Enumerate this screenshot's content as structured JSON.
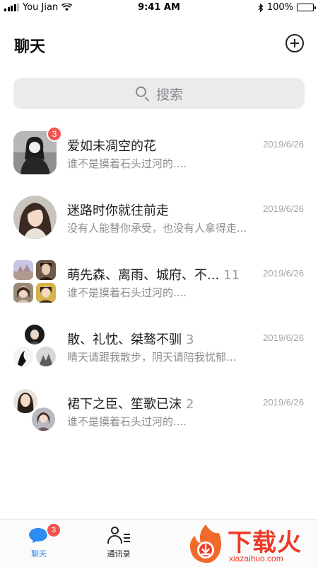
{
  "status_bar": {
    "carrier": "You Jian",
    "time": "9:41 AM",
    "battery": "100%"
  },
  "header": {
    "title": "聊天",
    "add_icon": "plus-circle-icon"
  },
  "search": {
    "placeholder": "搜索",
    "icon": "search-icon"
  },
  "chats": [
    {
      "name": "爱如未凋空的花",
      "count": "",
      "message": "谁不是摸着石头过河的....",
      "date": "2019/6/26",
      "badge": "3"
    },
    {
      "name": "迷路时你就往前走",
      "count": "",
      "message": "没有人能替你承受，也没有人拿得走...",
      "date": "2019/6/26",
      "badge": ""
    },
    {
      "name": "萌先森、离雨、城府、不...",
      "count": "11",
      "message": "谁不是摸着石头过河的....",
      "date": "2019/6/26",
      "badge": ""
    },
    {
      "name": "散、礼忱、桀骜不驯",
      "count": "3",
      "message": "晴天请跟我散步，阴天请陪我忧郁...",
      "date": "2019/6/26",
      "badge": ""
    },
    {
      "name": "裙下之臣、笙歌已沫",
      "count": "2",
      "message": "谁不是摸着石头过河的....",
      "date": "2019/6/26",
      "badge": ""
    }
  ],
  "tabbar": {
    "chat_label": "聊天",
    "chat_badge": "3",
    "contacts_label": "通讯录"
  },
  "watermark": {
    "text": "下载火",
    "url": "xiazaihuo.com"
  },
  "colors": {
    "accent": "#2b8cf3",
    "badge": "#f25350",
    "watermark": "#ee3a26"
  }
}
